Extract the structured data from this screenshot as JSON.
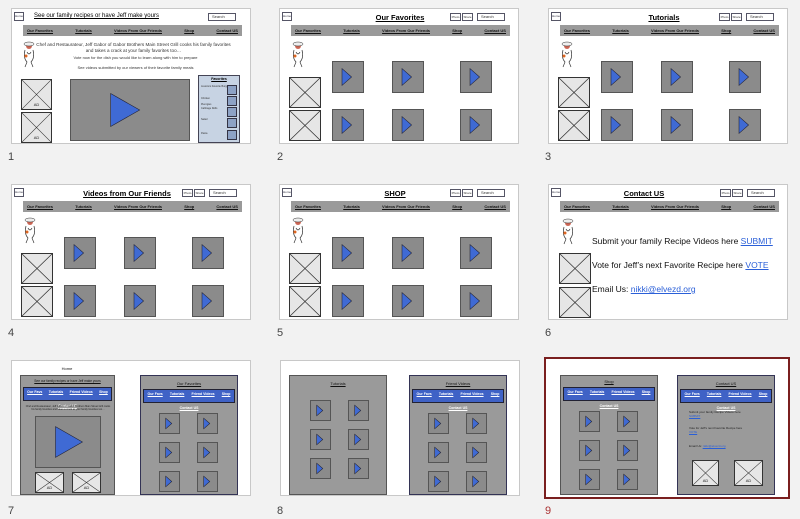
{
  "slides": [
    {
      "number": "1",
      "title": "See our family recipes or have Jeff make yours"
    },
    {
      "number": "2",
      "title": "Our Favorites"
    },
    {
      "number": "3",
      "title": "Tutorials"
    },
    {
      "number": "4",
      "title": "Videos from Our Friends"
    },
    {
      "number": "5",
      "title": "SHOP"
    },
    {
      "number": "6",
      "title": "Contact US"
    },
    {
      "number": "7"
    },
    {
      "number": "8"
    },
    {
      "number": "9"
    }
  ],
  "toolbar": {
    "home": "Home",
    "btn_a": "Photo",
    "btn_b": "Share",
    "search": "Search"
  },
  "nav": [
    "Our Favorites",
    "Tutorials",
    "Videos From Our Friends",
    "Shop",
    "Contact US"
  ],
  "slide1": {
    "intro": "Chef and Restaurateur, Jeff Gabor of Gabor Brothers Main Street Grill cooks his family favorites and takes a crack at your family favorites too…",
    "vote": "Vote now for the dish you would like to learn along with him to prepare",
    "videos": "See videos submitted by our viewers of their favorite family meals",
    "ad": "AD",
    "favorites_title": "Favorites",
    "fav_items": [
      "Jessica's Favorite Burger",
      "Chicken",
      "Pierogies",
      "Cabbage Rolls",
      "Salad",
      "Pasta"
    ]
  },
  "contact": {
    "submit_text": "Submit your family Recipe Videos here ",
    "submit_link": "SUBMIT",
    "vote_text": "Vote for Jeff’s next Favorite Recipe here ",
    "vote_link": "VOTE",
    "email_text": "Email Us: ",
    "email_link": "nikki@elvezd.org"
  },
  "mobile": {
    "home_label": "Home",
    "home_title": "See our family recipes or have Jeff make yours",
    "nav_row1": [
      "Our Favs",
      "Tutorials",
      "Friend Videos",
      "Shop"
    ],
    "nav_row2": "Contact US",
    "fav_title": "Our Favorites",
    "tut_title": "Tutorials",
    "friend_title": "Friend Videos",
    "shop_title": "Shop",
    "contact_title": "Contact US",
    "ad": "AD",
    "contact_submit": "Submit your family Recipe Videos here",
    "contact_submit_link": "SUBMIT",
    "contact_vote": "Vote for Jeff's next Favorite Recipe here",
    "contact_vote_link": "VOTE",
    "contact_email": "Email Us:",
    "contact_email_link": "nikki@elvezd.org"
  }
}
